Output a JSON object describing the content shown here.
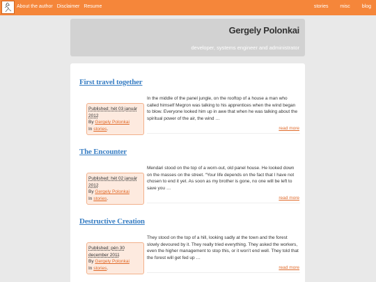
{
  "nav": {
    "left": [
      "About the author",
      "Disclaimer",
      "Resume"
    ],
    "right": [
      "stories",
      "misc",
      "blog"
    ]
  },
  "header": {
    "title": "Gergely Polonkai",
    "tagline": "developer, systems engineer and administrator"
  },
  "posts": [
    {
      "title": "First travel together",
      "published": "Published: hét 03 január 2012",
      "by_prefix": "By ",
      "author": "Gergely Polonkai",
      "in_prefix": "In ",
      "category": "stories",
      "in_suffix": ".",
      "excerpt": "In the middle of the panel jungle, on the rooftop of a house a man who called himself Megron was talking to his apprentices when the wind began to blow. Everyone looked him up in awe that when he was talking about the spiritual power of the air, the wind …",
      "read_more": "read more"
    },
    {
      "title": "The Encounter",
      "published": "Published: hét 02 január 2012",
      "by_prefix": "By ",
      "author": "Gergely Polonkai",
      "in_prefix": "In ",
      "category": "stories",
      "in_suffix": ".",
      "excerpt": "Mendari stood on the top of a worn-out, old panel house. He looked down on the masses on the street. “Your life depends on the fact that I have not chosen to end it yet. As soon as my brother is gone, no one will be left to save you …",
      "read_more": "read more"
    },
    {
      "title": "Destructive Creation",
      "published": "Published: pén 30 december 2011",
      "by_prefix": "By ",
      "author": "Gergely Polonkai",
      "in_prefix": "In ",
      "category": "stories",
      "in_suffix": ".",
      "excerpt": "They stood on the top of a hill, looking sadly at the town and the forest slowly devoured by it. They really tried everything. They asked the workers, even the higher management to stop this, or it won’t end well. They told that the forest will get fed up …",
      "read_more": "read more"
    }
  ],
  "colors": {
    "accent": "#f5863a",
    "link": "#3a7fc4",
    "meta_bg": "#fdeadf"
  }
}
